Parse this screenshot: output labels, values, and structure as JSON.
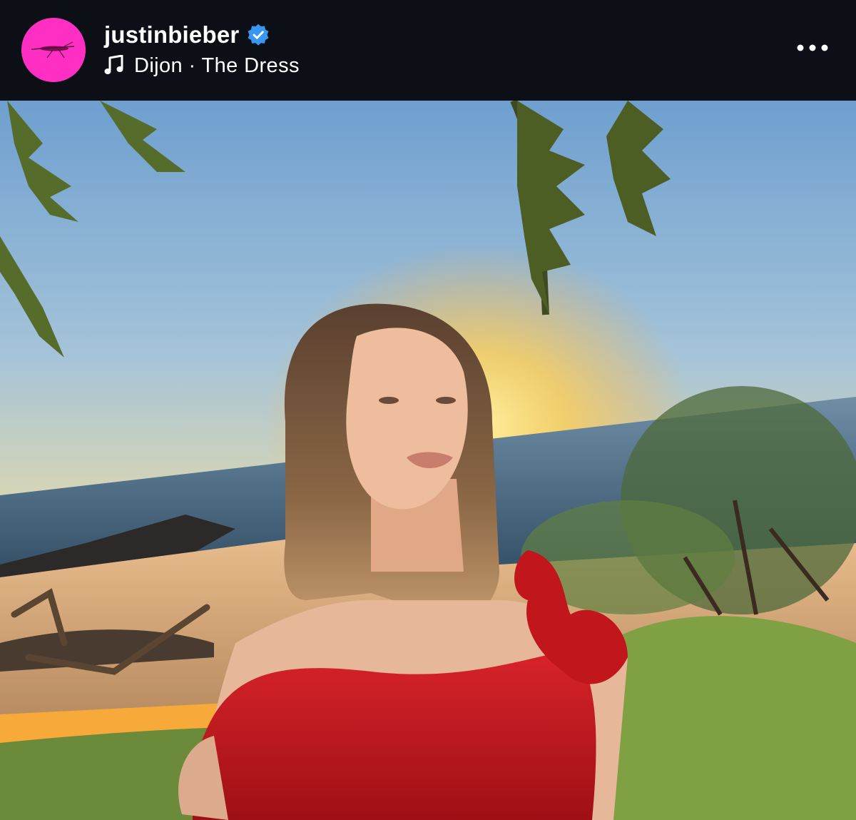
{
  "post": {
    "username": "justinbieber",
    "verified": true,
    "audio_label": "Dijon · The Dress",
    "colors": {
      "header_bg": "#0c0f16",
      "avatar_bg": "#ff2fc4",
      "verified_blue": "#3897f0",
      "text": "#ffffff"
    },
    "icons": {
      "avatar": "pink-insect-avatar",
      "verified": "verified-badge-icon",
      "music": "music-note-icon",
      "more": "more-options-icon"
    }
  }
}
